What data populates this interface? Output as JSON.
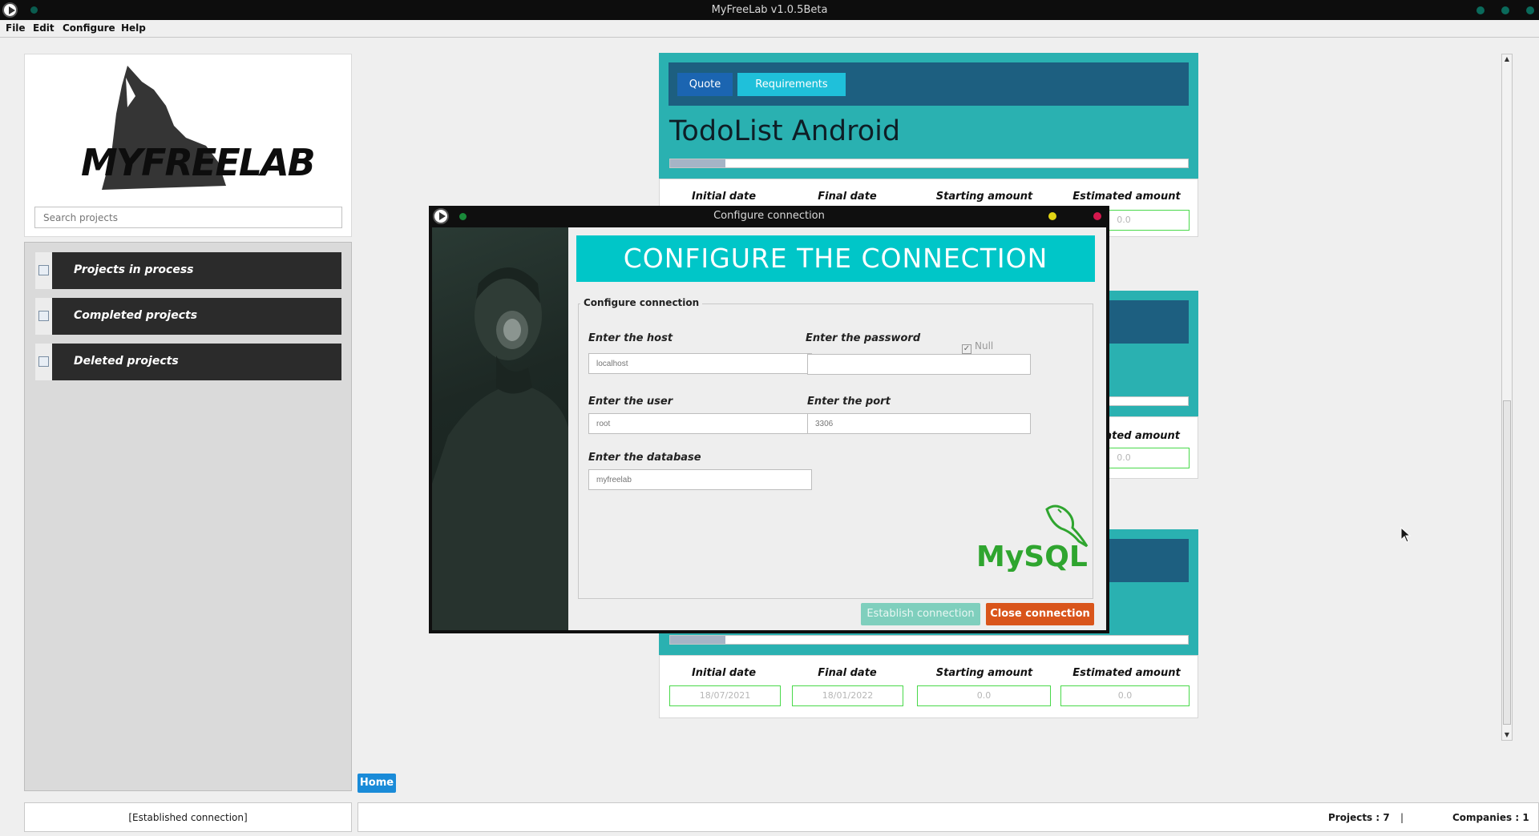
{
  "window": {
    "title": "MyFreeLab v1.0.5Beta",
    "controls": [
      "minimize",
      "maximize",
      "close"
    ]
  },
  "menubar": {
    "items": [
      "File",
      "Edit",
      "Configure",
      "Help"
    ]
  },
  "sidebar": {
    "logo_text": "MYFREELAB",
    "search_placeholder": "Search projects",
    "nav_items": [
      {
        "label": "Projects in process"
      },
      {
        "label": "Completed projects"
      },
      {
        "label": "Deleted projects"
      }
    ],
    "connection_status": "[Established connection]"
  },
  "main": {
    "home_button": "Home",
    "cards": [
      {
        "tabs": {
          "quote": "Quote",
          "requirements": "Requirements"
        },
        "title": "TodoList Android",
        "progress": 0.1,
        "columns": [
          "Initial date",
          "Final date",
          "Starting amount",
          "Estimated amount"
        ],
        "values": [
          "",
          "",
          "",
          "0.0"
        ]
      },
      {
        "columns": [
          "",
          "",
          "",
          "ated amount"
        ],
        "values": [
          "",
          "",
          "",
          "0.0"
        ]
      },
      {
        "progress": 0.1,
        "columns": [
          "Initial date",
          "Final date",
          "Starting amount",
          "Estimated amount"
        ],
        "values": [
          "18/07/2021",
          "18/01/2022",
          "0.0",
          "0.0"
        ]
      }
    ]
  },
  "statusbar": {
    "projects": "Projects : 7",
    "separator": "|",
    "companies": "Companies : 1"
  },
  "dialog": {
    "title": "Configure connection",
    "banner": "CONFIGURE THE CONNECTION",
    "group_label": "Configure connection",
    "host_label": "Enter the host",
    "host_placeholder": "localhost",
    "password_label": "Enter the password",
    "password_value": "",
    "null_label": "Null",
    "null_checked": true,
    "user_label": "Enter the user",
    "user_placeholder": "root",
    "port_label": "Enter the port",
    "port_placeholder": "3306",
    "database_label": "Enter the database",
    "database_placeholder": "myfreelab",
    "mysql_logo_text": "MySQL",
    "establish_button": "Establish connection",
    "close_button": "Close connection"
  },
  "colors": {
    "card_teal": "#2ab1b1",
    "card_header": "#1d5f80",
    "banner": "#00c6c8",
    "establish": "#7fcfbd",
    "close": "#d9551b",
    "field_border": "#49d94a"
  }
}
